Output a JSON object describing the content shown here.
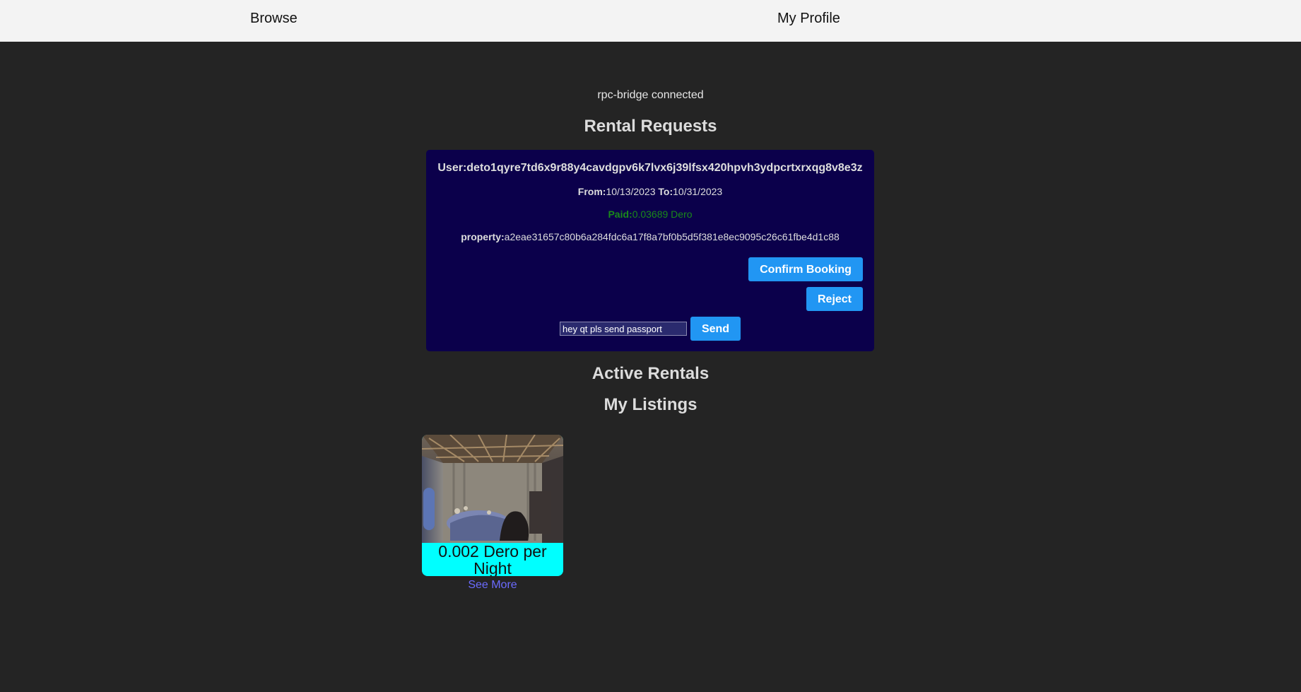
{
  "nav": {
    "browse": "Browse",
    "profile": "My Profile"
  },
  "status": "rpc-bridge connected",
  "rental_requests": {
    "heading": "Rental Requests",
    "request": {
      "user_label": "User:",
      "user": "deto1qyre7td6x9r88y4cavdgpv6k7lvx6j39lfsx420hpvh3ydpcrtxrxqg8v8e3z",
      "from_label": "From:",
      "from": "10/13/2023",
      "to_label": "To:",
      "to": "10/31/2023",
      "paid_label": "Paid:",
      "paid": "0.03689 Dero",
      "property_label": "property:",
      "property": "a2eae31657c80b6a284fdc6a17f8a7bf0b5d5f381e8ec9095c26c61fbe4d1c88",
      "confirm_label": "Confirm Booking",
      "reject_label": "Reject",
      "message_value": "hey qt pls send passport",
      "send_label": "Send"
    }
  },
  "active_rentals": {
    "heading": "Active Rentals"
  },
  "my_listings": {
    "heading": "My Listings",
    "items": [
      {
        "price": "0.002 Dero per Night",
        "see_more": "See More"
      }
    ]
  },
  "colors": {
    "background": "#242424",
    "nav_bg": "#f3f3f3",
    "card_bg": "#0b004b",
    "button": "#2196f3",
    "paid": "#1a8a1a",
    "price_bg": "#00ffff",
    "link": "#6b6bff"
  }
}
